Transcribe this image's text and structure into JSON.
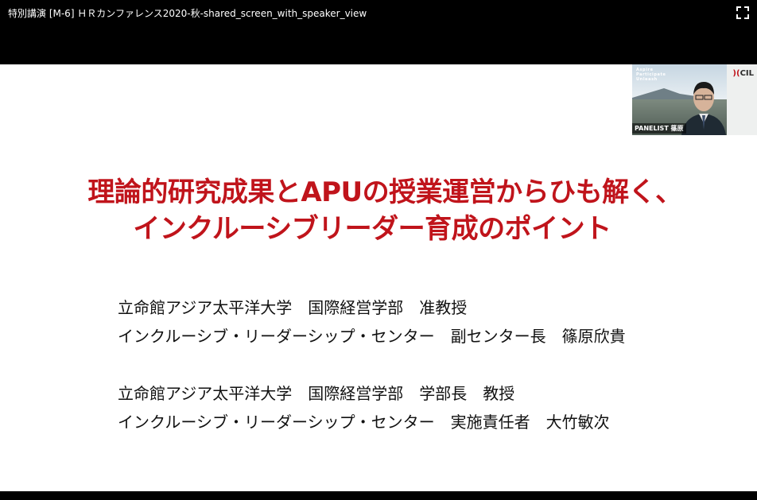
{
  "window": {
    "title": "特別講演 [M-6] ＨＲカンファレンス2020-秋-shared_screen_with_speaker_view"
  },
  "slide": {
    "title_lines": [
      "理論的研究成果とAPUの授業運営からひも解く、",
      "インクルーシブリーダー育成のポイント"
    ],
    "presenters": [
      "立命館アジア太平洋大学　国際経営学部　准教授",
      "インクルーシブ・リーダーシップ・センター　副センター長　篠原欣貴",
      "立命館アジア太平洋大学　国際経営学部　学部長　教授",
      "インクルーシブ・リーダーシップ・センター　実施責任者　大竹敏次"
    ]
  },
  "speaker": {
    "label": "PANELIST 篠原",
    "logo_text": "CIL",
    "tagline": [
      "Aspire",
      "Participate",
      "Unleash"
    ]
  },
  "colors": {
    "title_red": "#c0141b",
    "background": "#ffffff",
    "chrome": "#000000"
  },
  "icons": {
    "fullscreen": "fullscreen-icon"
  }
}
